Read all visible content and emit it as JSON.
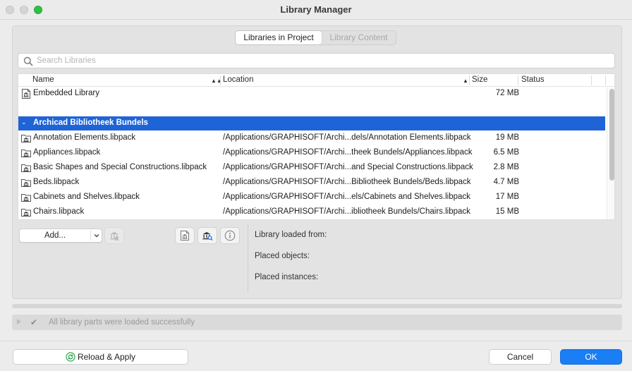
{
  "window": {
    "title": "Library Manager"
  },
  "tabs": {
    "active": "Libraries in Project",
    "inactive": "Library Content"
  },
  "search": {
    "placeholder": "Search Libraries",
    "value": ""
  },
  "table": {
    "columns": {
      "name": "Name",
      "location": "Location",
      "size": "Size",
      "status": "Status"
    },
    "embedded": {
      "name": "Embedded Library",
      "location": "",
      "size": "72 MB",
      "status": ""
    },
    "group": {
      "label": "Archicad Bibliotheek Bundels"
    },
    "rows": [
      {
        "name": "Annotation Elements.libpack",
        "location": "/Applications/GRAPHISOFT/Archi...dels/Annotation Elements.libpack",
        "size": "19 MB"
      },
      {
        "name": "Appliances.libpack",
        "location": "/Applications/GRAPHISOFT/Archi...theek Bundels/Appliances.libpack",
        "size": "6.5 MB"
      },
      {
        "name": "Basic Shapes and Special Constructions.libpack",
        "location": "/Applications/GRAPHISOFT/Archi...and Special Constructions.libpack",
        "size": "2.8 MB"
      },
      {
        "name": "Beds.libpack",
        "location": "/Applications/GRAPHISOFT/Archi...Bibliotheek Bundels/Beds.libpack",
        "size": "4.7 MB"
      },
      {
        "name": "Cabinets and Shelves.libpack",
        "location": "/Applications/GRAPHISOFT/Archi...els/Cabinets and Shelves.libpack",
        "size": "17 MB"
      },
      {
        "name": "Chairs.libpack",
        "location": "/Applications/GRAPHISOFT/Archi...ibliotheek Bundels/Chairs.libpack",
        "size": "15 MB"
      }
    ]
  },
  "actions": {
    "add_label": "Add..."
  },
  "details": {
    "loaded_from": "Library loaded from:",
    "placed_objects": "Placed objects:",
    "placed_instances": "Placed instances:"
  },
  "status": {
    "message": "All library parts were loaded successfully",
    "check_glyph": "✔"
  },
  "footer": {
    "reload_label": "Reload & Apply",
    "cancel_label": "Cancel",
    "ok_label": "OK"
  },
  "colors": {
    "accent": "#1f64d6",
    "ok_button": "#1a7ef5",
    "zoom_light": "#2fc145"
  }
}
